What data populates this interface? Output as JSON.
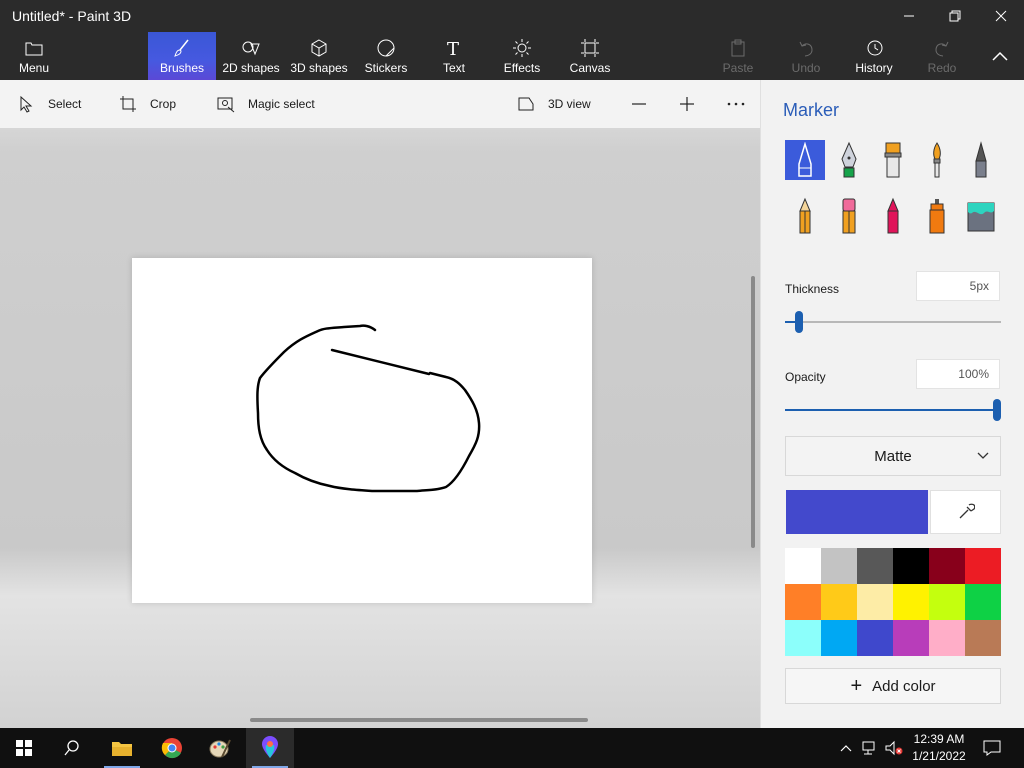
{
  "window": {
    "title": "Untitled* - Paint 3D"
  },
  "ribbon": {
    "menu": "Menu",
    "brushes": "Brushes",
    "shapes2d": "2D shapes",
    "shapes3d": "3D shapes",
    "stickers": "Stickers",
    "text": "Text",
    "effects": "Effects",
    "canvas": "Canvas",
    "paste": "Paste",
    "undo": "Undo",
    "history": "History",
    "redo": "Redo"
  },
  "toolbar": {
    "select": "Select",
    "crop": "Crop",
    "magic_select": "Magic select",
    "view3d": "3D view"
  },
  "panel": {
    "title": "Marker",
    "brushes": [
      "marker-icon",
      "calligraphy-pen-icon",
      "oil-brush-icon",
      "watercolor-icon",
      "pixel-pen-icon",
      "pencil-icon",
      "eraser-icon",
      "crayon-icon",
      "spray-can-icon",
      "fill-icon"
    ],
    "selected_brush": "marker-icon",
    "thickness_label": "Thickness",
    "thickness_value": "5px",
    "thickness_fraction": 0.05,
    "opacity_label": "Opacity",
    "opacity_value": "100%",
    "opacity_fraction": 1.0,
    "finish": "Matte",
    "current_color": "#4349cc",
    "palette": [
      "#ffffff",
      "#c3c3c3",
      "#585858",
      "#000000",
      "#88001b",
      "#ec1c24",
      "#ff7f27",
      "#ffca18",
      "#fdeca6",
      "#fff200",
      "#c4ff0e",
      "#0ed145",
      "#8cfffb",
      "#00a8f3",
      "#3f48cc",
      "#b83dba",
      "#ffaec8",
      "#b97a56"
    ],
    "add_color": "Add color"
  },
  "taskbar": {
    "time": "12:39 AM",
    "date": "1/21/2022"
  }
}
